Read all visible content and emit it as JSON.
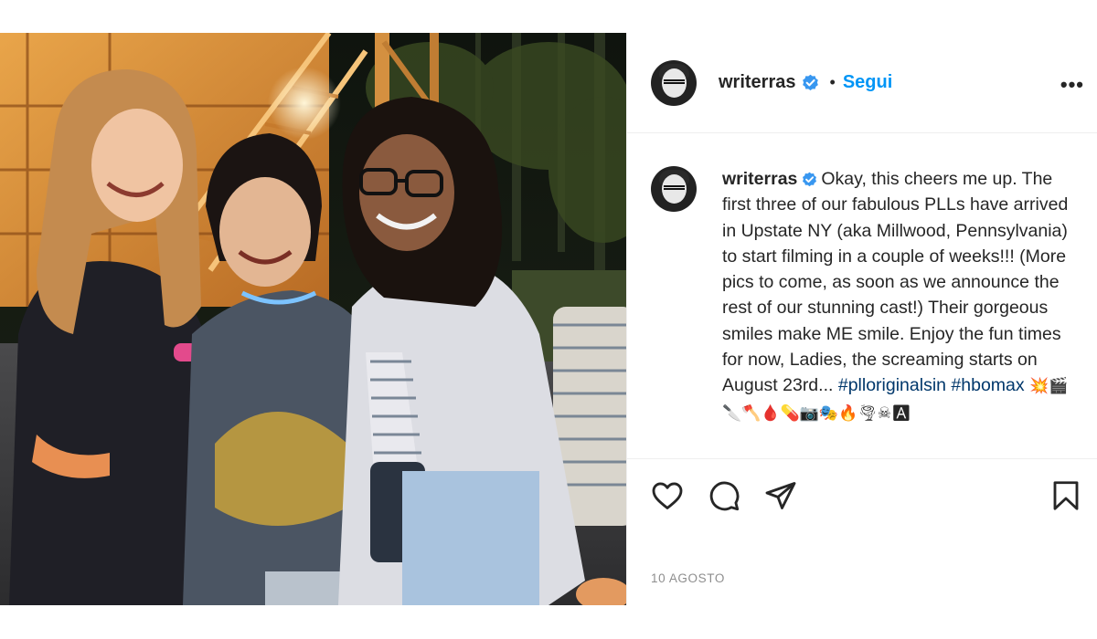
{
  "post": {
    "username": "writerras",
    "follow_label": "Segui",
    "separator": "•",
    "more_label": "•••",
    "caption_username": "writerras",
    "caption_text": "Okay, this cheers me up. The first three of our fabulous PLLs have arrived in Upstate NY (aka Millwood, Pennsylvania) to start filming in a couple of weeks!!! (More pics to come, as soon as we announce the rest of our stunning cast!) Their gorgeous smiles make ME smile. Enjoy the fun times for now, Ladies, the screaming starts on August 23rd...",
    "hashtag_1": "#plloriginalsin",
    "hashtag_2": "#hbomax",
    "emojis": "💥🎬🔪🪓🩸💊📷🎭🔥🌪☠🅰",
    "date": "10 AGOSTO"
  },
  "icons": {
    "verified": "verified-badge-icon",
    "like": "heart-icon",
    "comment": "comment-bubble-icon",
    "share": "paper-plane-icon",
    "save": "bookmark-icon"
  },
  "colors": {
    "follow_blue": "#0095f6",
    "verified_blue": "#3897f0",
    "hashtag": "#00376b",
    "date_gray": "#8e8e8e"
  }
}
